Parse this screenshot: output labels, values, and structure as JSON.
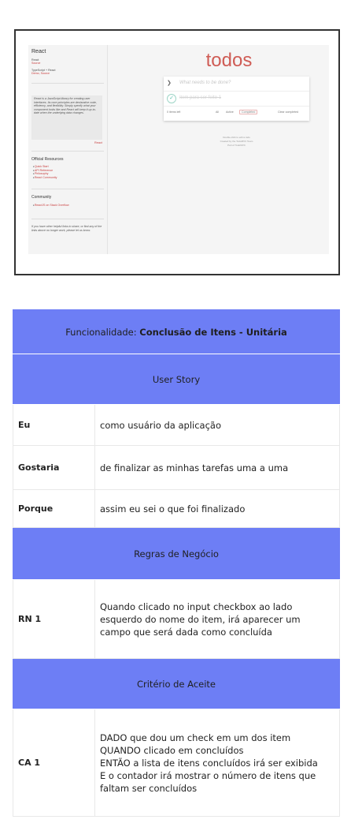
{
  "screenshot": {
    "sidebar": {
      "title": "React",
      "react_label": "React",
      "react_link": "Source",
      "ts_label": "TypeScript + React",
      "ts_link": "Demo, Source",
      "quote": "React is a JavaScript library for creating user interfaces. Its core principles are declarative code, efficiency, and flexibility. Simply specify what your component looks like and React will keep it up-to-date when the underlying data changes.",
      "read_more": "React",
      "resources_heading": "Official Resources",
      "resources": [
        "Quick Start",
        "API Reference",
        "Philosophy",
        "React Community"
      ],
      "community_heading": "Community",
      "community": [
        "ReactJS on Stack Overflow"
      ],
      "footer_note": "If you have other helpful links to share, or find any of the links above no longer work, please let us know."
    },
    "todo": {
      "title": "todos",
      "placeholder": "What needs to be done?",
      "item": "item para ser feito 1",
      "items_left": "0 items left",
      "filter_all": "All",
      "filter_active": "Active",
      "filter_completed": "Completed",
      "clear_completed": "Clear completed",
      "info_1": "Double-click to edit a todo",
      "info_2": "Created by the TodoMVC Team",
      "info_3": "Part of TodoMVC"
    }
  },
  "spec": {
    "feature_prefix": "Funcionalidade: ",
    "feature_name": "Conclusão de Itens - Unitária",
    "user_story_header": "User Story",
    "rows": [
      {
        "label": "Eu",
        "value": "como  usuário da aplicação"
      },
      {
        "label": "Gostaria",
        "value": "de finalizar as minhas tarefas uma a uma"
      },
      {
        "label": "Porque",
        "value": "assim eu sei o que foi finalizado"
      }
    ],
    "rules_header": "Regras de Negócio",
    "rule": {
      "label": "RN 1",
      "value": "Quando clicado no input checkbox ao lado\nesquerdo do nome do item, irá aparecer um\ncampo que será dada como concluída"
    },
    "criteria_header": "Critério de Aceite",
    "criteria": {
      "label": "CA 1",
      "value": "DADO que dou um check em um dos item\nQUANDO clicado em concluídos\nENTÃO a lista de itens concluídos irá ser exibida\nE o contador irá mostrar o número de itens que\nfaltam ser concluídos"
    },
    "colors": {
      "header_bg": "#6d7ef5",
      "todo_red": "#c9423a"
    }
  }
}
